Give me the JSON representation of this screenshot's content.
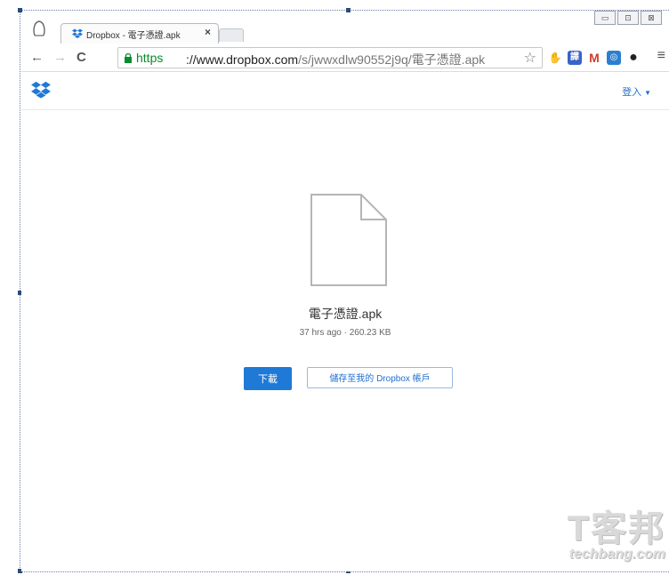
{
  "browser": {
    "tab_title": "Dropbox - 電子憑證.apk",
    "tab_close": "×",
    "window_buttons": [
      "▭",
      "⊡",
      "⊠"
    ],
    "url_scheme": "https",
    "url_host": "://www.dropbox.com",
    "url_path": "/s/jwwxdlw90552j9q/電子憑證.apk",
    "nav": {
      "back": "←",
      "forward": "→",
      "reload": "C"
    },
    "star": "☆",
    "menu": "≡",
    "extensions": [
      {
        "icon": "hand-icon",
        "label": "✋",
        "color": "#ffffff"
      },
      {
        "icon": "translate-icon",
        "label": "譯",
        "color": "#3a63c8"
      },
      {
        "icon": "gmail-icon",
        "label": "M",
        "color": "#d23c2f"
      },
      {
        "icon": "globe-icon",
        "label": "◎",
        "color": "#2b7fd0"
      },
      {
        "icon": "circle-icon",
        "label": "●",
        "color": "#222222"
      }
    ]
  },
  "header": {
    "login_label": "登入",
    "login_caret": "▼"
  },
  "file": {
    "name": "電子憑證.apk",
    "meta": "37 hrs ago · 260.23 KB"
  },
  "actions": {
    "download_label": "下載",
    "save_label": "儲存至我的 Dropbox 帳戶"
  },
  "watermark": {
    "cn": "T客邦",
    "en": "techbang.com"
  },
  "colors": {
    "accent": "#1f79d6",
    "https_green": "#0b8a2e"
  }
}
